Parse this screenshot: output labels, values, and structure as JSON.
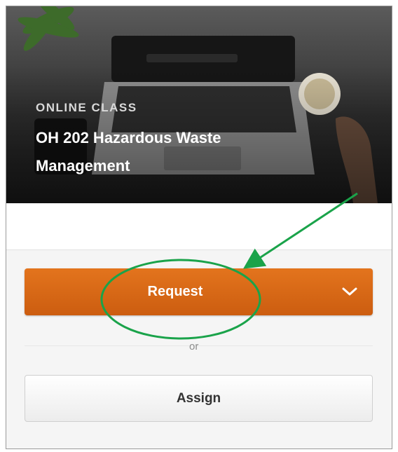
{
  "card": {
    "eyebrow": "ONLINE CLASS",
    "title": "OH 202 Hazardous Waste Management"
  },
  "actions": {
    "primary_label": "Request",
    "separator": "or",
    "secondary_label": "Assign"
  },
  "icons": {
    "dropdown": "chevron-down-icon"
  },
  "colors": {
    "primary": "#d96a16",
    "annotation": "#1aa34a"
  }
}
